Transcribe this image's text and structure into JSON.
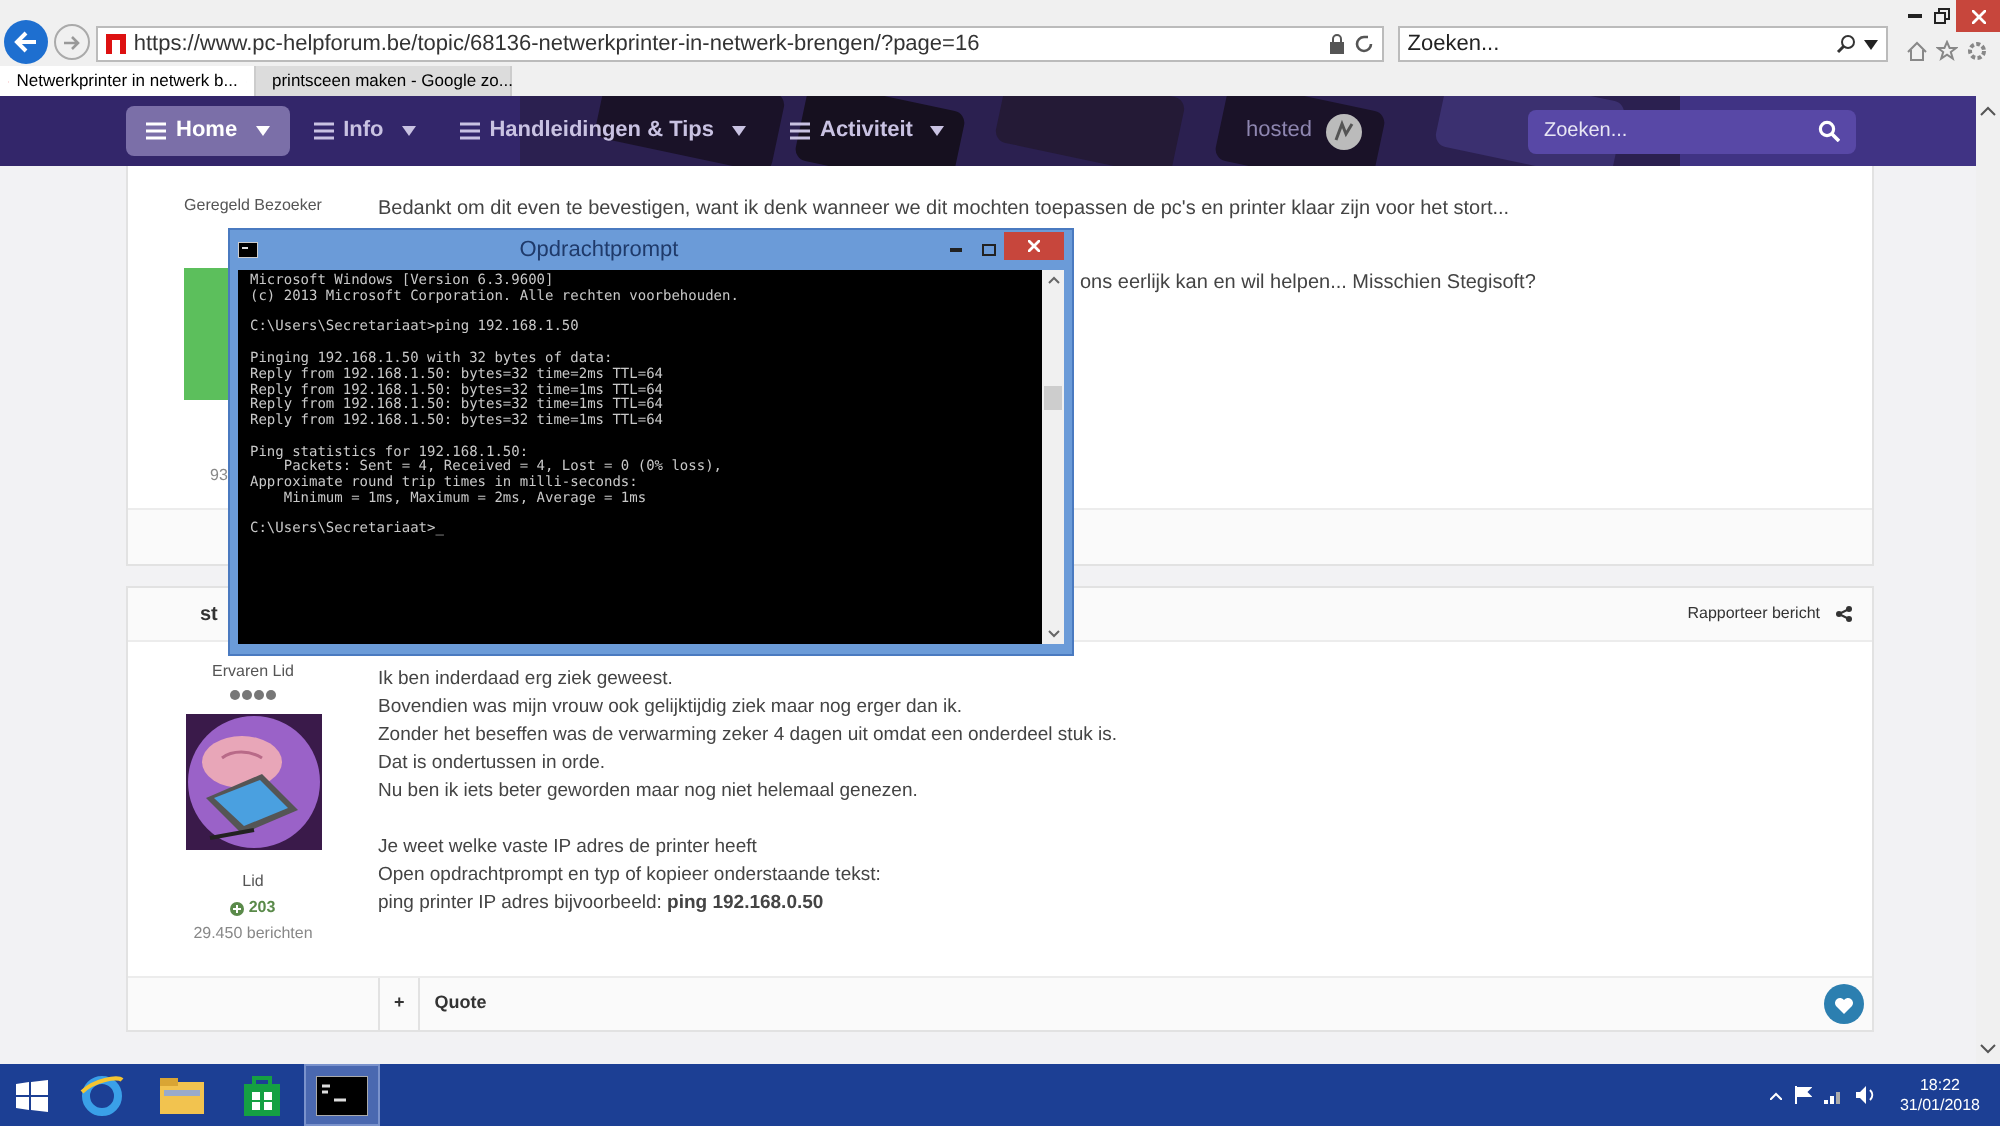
{
  "browser": {
    "address": "https://www.pc-helpforum.be/topic/68136-netwerkprinter-in-netwerk-brengen/?page=16",
    "search": {
      "placeholder": "Zoeken..."
    },
    "tabs": [
      {
        "label": "Netwerkprinter in netwerk b...",
        "selected": true
      },
      {
        "label": "printsceen maken - Google zo...",
        "selected": false
      }
    ]
  },
  "nav": {
    "items": [
      {
        "label": "Home",
        "selected": true
      },
      {
        "label": "Info",
        "selected": false
      },
      {
        "label": "Handleidingen & Tips",
        "selected": false
      },
      {
        "label": "Activiteit",
        "selected": false
      }
    ],
    "hosted": "hosted",
    "search": {
      "placeholder": "Zoeken..."
    }
  },
  "posts": [
    {
      "rank": "Geregeld Bezoeker",
      "count_partial": "93",
      "lines": [
        "Bedankt om dit even te bevestigen, want ik denk wanneer we dit mochten toepassen de pc's en printer klaar zijn voor het stort...",
        "ons eerlijk kan en wil helpen... Misschien Stegisoft?"
      ]
    },
    {
      "author": "st",
      "report": "Rapporteer bericht",
      "rank": "Ervaren Lid",
      "stars": 4,
      "group": "Lid",
      "reputation": "203",
      "post_count": "29.450 berichten",
      "paragraphs": [
        [
          "Ik ben inderdaad erg ziek geweest.",
          "Bovendien was mijn vrouw ook gelijktijdig ziek maar nog erger dan ik.",
          "Zonder het beseffen was de verwarming zeker 4 dagen uit omdat een onderdeel stuk is.",
          "Dat is ondertussen in orde.",
          "Nu ben ik iets beter geworden maar nog niet helemaal genezen."
        ],
        [
          "Je weet welke vaste IP adres de printer heeft",
          "Open opdrachtprompt en typ of kopieer onderstaande tekst:",
          "ping printer IP adres bijvoorbeeld: **ping 192.168.0.50**"
        ]
      ],
      "actions": [
        "+",
        "Quote"
      ]
    }
  ],
  "console": {
    "title": "Opdrachtprompt",
    "blocks": [
      [
        "Microsoft Windows [Version 6.3.9600]",
        "(c) 2013 Microsoft Corporation. Alle rechten voorbehouden."
      ],
      [
        "C:\\Users\\Secretariaat>ping 192.168.1.50"
      ],
      [
        "Pinging 192.168.1.50 with 32 bytes of data:",
        "Reply from 192.168.1.50: bytes=32 time=2ms TTL=64",
        "Reply from 192.168.1.50: bytes=32 time=1ms TTL=64",
        "Reply from 192.168.1.50: bytes=32 time=1ms TTL=64",
        "Reply from 192.168.1.50: bytes=32 time=1ms TTL=64"
      ],
      [
        "Ping statistics for 192.168.1.50:",
        "    Packets: Sent = 4, Received = 4, Lost = 0 (0% loss),",
        "Approximate round trip times in milli-seconds:",
        "    Minimum = 1ms, Maximum = 2ms, Average = 1ms"
      ],
      [
        "C:\\Users\\Secretariaat>_"
      ]
    ]
  },
  "taskbar": {
    "apps": [
      {
        "kind": "ie",
        "selected": false
      },
      {
        "kind": "explorer",
        "selected": false
      },
      {
        "kind": "store",
        "selected": false
      },
      {
        "kind": "console",
        "selected": true
      }
    ],
    "time": "18:22",
    "date": "31/01/2018"
  }
}
